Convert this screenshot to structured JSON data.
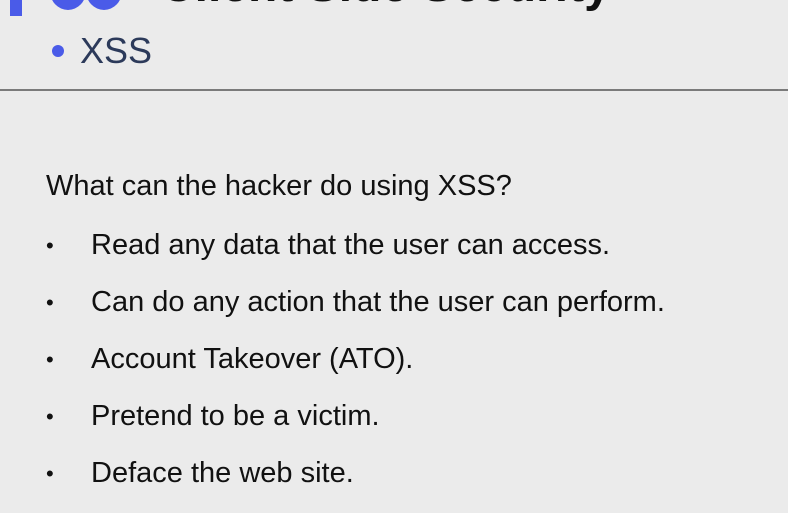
{
  "header": {
    "title": "Client Side Security",
    "subtitle": "XSS",
    "accent_color": "#4a5be8"
  },
  "content": {
    "question": "What can the hacker do using XSS?",
    "bullets": [
      "Read any data that the user can access.",
      "Can do any action that the user can perform.",
      "Account Takeover (ATO).",
      "Pretend to be a victim.",
      "Deface the web site."
    ],
    "bullet_glyph": "•"
  }
}
